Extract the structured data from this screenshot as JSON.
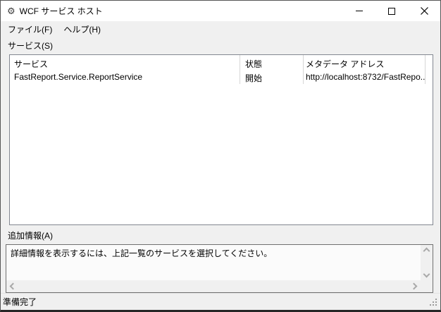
{
  "window": {
    "title": "WCF サービス ホスト",
    "icons": {
      "gear": "⚙"
    }
  },
  "menu": {
    "items": [
      {
        "label": "ファイル(F)"
      },
      {
        "label": "ヘルプ(H)"
      }
    ]
  },
  "services": {
    "label": "サービス(S)",
    "columns": [
      {
        "label": "サービス"
      },
      {
        "label": "状態"
      },
      {
        "label": "メタデータ アドレス"
      }
    ],
    "rows": [
      {
        "service": "FastReport.Service.ReportService",
        "status": "開始",
        "metadata_address": "http://localhost:8732/FastRepo..."
      }
    ]
  },
  "additional_info": {
    "label": "追加情報(A)",
    "text": "詳細情報を表示するには、上記一覧のサービスを選択してください。"
  },
  "status_bar": {
    "text": "準備完了"
  },
  "colors": {
    "titlebar_bg": "#ffffff",
    "window_bg": "#f0f0f0",
    "list_bg": "#ffffff",
    "list_border": "#828790",
    "infobox_border": "#707070",
    "scrollbar_track": "#f0f0f0",
    "scrollbar_arrow": "#a9a9a9"
  }
}
